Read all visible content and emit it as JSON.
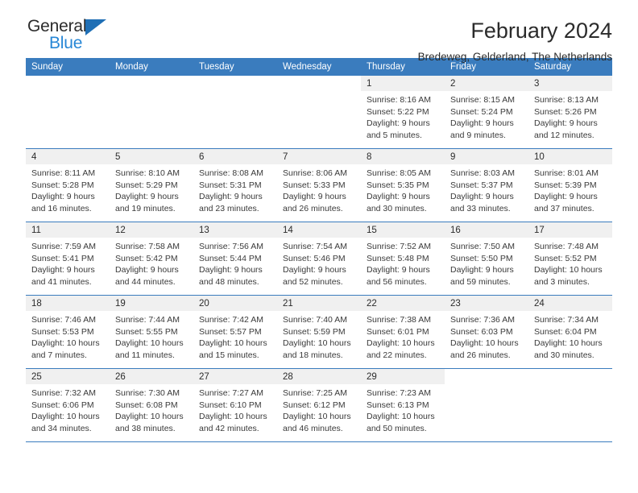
{
  "logo": {
    "word_top": "General",
    "word_bottom": "Blue",
    "triangle_icon": "triangle-icon",
    "accent_color": "#2787d6",
    "triangle_color": "#1f6fb5"
  },
  "header": {
    "title": "February 2024",
    "subtitle": "Bredeweg, Gelderland, The Netherlands"
  },
  "theme": {
    "header_bg": "#3a7cbe",
    "daynum_bg": "#f0f0f0",
    "rule_color": "#3a7cbe",
    "text_color": "#2b2b2b"
  },
  "calendar": {
    "day_headers": [
      "Sunday",
      "Monday",
      "Tuesday",
      "Wednesday",
      "Thursday",
      "Friday",
      "Saturday"
    ],
    "weeks": [
      [
        {
          "day": "",
          "blank": true
        },
        {
          "day": "",
          "blank": true
        },
        {
          "day": "",
          "blank": true
        },
        {
          "day": "",
          "blank": true
        },
        {
          "day": "1",
          "sunrise": "Sunrise: 8:16 AM",
          "sunset": "Sunset: 5:22 PM",
          "daylight1": "Daylight: 9 hours",
          "daylight2": "and 5 minutes."
        },
        {
          "day": "2",
          "sunrise": "Sunrise: 8:15 AM",
          "sunset": "Sunset: 5:24 PM",
          "daylight1": "Daylight: 9 hours",
          "daylight2": "and 9 minutes."
        },
        {
          "day": "3",
          "sunrise": "Sunrise: 8:13 AM",
          "sunset": "Sunset: 5:26 PM",
          "daylight1": "Daylight: 9 hours",
          "daylight2": "and 12 minutes."
        }
      ],
      [
        {
          "day": "4",
          "sunrise": "Sunrise: 8:11 AM",
          "sunset": "Sunset: 5:28 PM",
          "daylight1": "Daylight: 9 hours",
          "daylight2": "and 16 minutes."
        },
        {
          "day": "5",
          "sunrise": "Sunrise: 8:10 AM",
          "sunset": "Sunset: 5:29 PM",
          "daylight1": "Daylight: 9 hours",
          "daylight2": "and 19 minutes."
        },
        {
          "day": "6",
          "sunrise": "Sunrise: 8:08 AM",
          "sunset": "Sunset: 5:31 PM",
          "daylight1": "Daylight: 9 hours",
          "daylight2": "and 23 minutes."
        },
        {
          "day": "7",
          "sunrise": "Sunrise: 8:06 AM",
          "sunset": "Sunset: 5:33 PM",
          "daylight1": "Daylight: 9 hours",
          "daylight2": "and 26 minutes."
        },
        {
          "day": "8",
          "sunrise": "Sunrise: 8:05 AM",
          "sunset": "Sunset: 5:35 PM",
          "daylight1": "Daylight: 9 hours",
          "daylight2": "and 30 minutes."
        },
        {
          "day": "9",
          "sunrise": "Sunrise: 8:03 AM",
          "sunset": "Sunset: 5:37 PM",
          "daylight1": "Daylight: 9 hours",
          "daylight2": "and 33 minutes."
        },
        {
          "day": "10",
          "sunrise": "Sunrise: 8:01 AM",
          "sunset": "Sunset: 5:39 PM",
          "daylight1": "Daylight: 9 hours",
          "daylight2": "and 37 minutes."
        }
      ],
      [
        {
          "day": "11",
          "sunrise": "Sunrise: 7:59 AM",
          "sunset": "Sunset: 5:41 PM",
          "daylight1": "Daylight: 9 hours",
          "daylight2": "and 41 minutes."
        },
        {
          "day": "12",
          "sunrise": "Sunrise: 7:58 AM",
          "sunset": "Sunset: 5:42 PM",
          "daylight1": "Daylight: 9 hours",
          "daylight2": "and 44 minutes."
        },
        {
          "day": "13",
          "sunrise": "Sunrise: 7:56 AM",
          "sunset": "Sunset: 5:44 PM",
          "daylight1": "Daylight: 9 hours",
          "daylight2": "and 48 minutes."
        },
        {
          "day": "14",
          "sunrise": "Sunrise: 7:54 AM",
          "sunset": "Sunset: 5:46 PM",
          "daylight1": "Daylight: 9 hours",
          "daylight2": "and 52 minutes."
        },
        {
          "day": "15",
          "sunrise": "Sunrise: 7:52 AM",
          "sunset": "Sunset: 5:48 PM",
          "daylight1": "Daylight: 9 hours",
          "daylight2": "and 56 minutes."
        },
        {
          "day": "16",
          "sunrise": "Sunrise: 7:50 AM",
          "sunset": "Sunset: 5:50 PM",
          "daylight1": "Daylight: 9 hours",
          "daylight2": "and 59 minutes."
        },
        {
          "day": "17",
          "sunrise": "Sunrise: 7:48 AM",
          "sunset": "Sunset: 5:52 PM",
          "daylight1": "Daylight: 10 hours",
          "daylight2": "and 3 minutes."
        }
      ],
      [
        {
          "day": "18",
          "sunrise": "Sunrise: 7:46 AM",
          "sunset": "Sunset: 5:53 PM",
          "daylight1": "Daylight: 10 hours",
          "daylight2": "and 7 minutes."
        },
        {
          "day": "19",
          "sunrise": "Sunrise: 7:44 AM",
          "sunset": "Sunset: 5:55 PM",
          "daylight1": "Daylight: 10 hours",
          "daylight2": "and 11 minutes."
        },
        {
          "day": "20",
          "sunrise": "Sunrise: 7:42 AM",
          "sunset": "Sunset: 5:57 PM",
          "daylight1": "Daylight: 10 hours",
          "daylight2": "and 15 minutes."
        },
        {
          "day": "21",
          "sunrise": "Sunrise: 7:40 AM",
          "sunset": "Sunset: 5:59 PM",
          "daylight1": "Daylight: 10 hours",
          "daylight2": "and 18 minutes."
        },
        {
          "day": "22",
          "sunrise": "Sunrise: 7:38 AM",
          "sunset": "Sunset: 6:01 PM",
          "daylight1": "Daylight: 10 hours",
          "daylight2": "and 22 minutes."
        },
        {
          "day": "23",
          "sunrise": "Sunrise: 7:36 AM",
          "sunset": "Sunset: 6:03 PM",
          "daylight1": "Daylight: 10 hours",
          "daylight2": "and 26 minutes."
        },
        {
          "day": "24",
          "sunrise": "Sunrise: 7:34 AM",
          "sunset": "Sunset: 6:04 PM",
          "daylight1": "Daylight: 10 hours",
          "daylight2": "and 30 minutes."
        }
      ],
      [
        {
          "day": "25",
          "sunrise": "Sunrise: 7:32 AM",
          "sunset": "Sunset: 6:06 PM",
          "daylight1": "Daylight: 10 hours",
          "daylight2": "and 34 minutes."
        },
        {
          "day": "26",
          "sunrise": "Sunrise: 7:30 AM",
          "sunset": "Sunset: 6:08 PM",
          "daylight1": "Daylight: 10 hours",
          "daylight2": "and 38 minutes."
        },
        {
          "day": "27",
          "sunrise": "Sunrise: 7:27 AM",
          "sunset": "Sunset: 6:10 PM",
          "daylight1": "Daylight: 10 hours",
          "daylight2": "and 42 minutes."
        },
        {
          "day": "28",
          "sunrise": "Sunrise: 7:25 AM",
          "sunset": "Sunset: 6:12 PM",
          "daylight1": "Daylight: 10 hours",
          "daylight2": "and 46 minutes."
        },
        {
          "day": "29",
          "sunrise": "Sunrise: 7:23 AM",
          "sunset": "Sunset: 6:13 PM",
          "daylight1": "Daylight: 10 hours",
          "daylight2": "and 50 minutes."
        },
        {
          "day": "",
          "blank": true
        },
        {
          "day": "",
          "blank": true
        }
      ]
    ]
  }
}
